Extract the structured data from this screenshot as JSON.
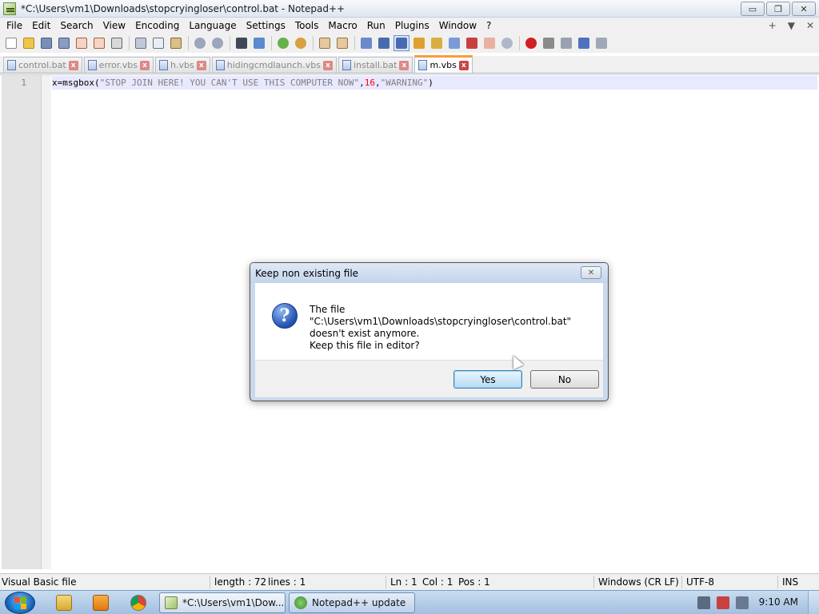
{
  "window": {
    "title": "*C:\\Users\\vm1\\Downloads\\stopcryingloser\\control.bat - Notepad++",
    "minimize_label": "▭",
    "restore_label": "❐",
    "close_label": "✕"
  },
  "menu": {
    "items": [
      "File",
      "Edit",
      "Search",
      "View",
      "Encoding",
      "Language",
      "Settings",
      "Tools",
      "Macro",
      "Run",
      "Plugins",
      "Window",
      "?"
    ],
    "right": [
      "+",
      "▼",
      "✕"
    ]
  },
  "tabs": [
    {
      "label": "control.bat",
      "active": false
    },
    {
      "label": "error.vbs",
      "active": false
    },
    {
      "label": "h.vbs",
      "active": false
    },
    {
      "label": "hidingcmdlaunch.vbs",
      "active": false
    },
    {
      "label": "install.bat",
      "active": false
    },
    {
      "label": "m.vbs",
      "active": true
    }
  ],
  "editor": {
    "line_number": "1",
    "code": {
      "part1": "x=msgbox(",
      "part2": "\"STOP JOIN HERE! YOU CAN'T USE THIS COMPUTER NOW\"",
      "part3": ",",
      "part4": "16",
      "part5": ",",
      "part6": "\"WARNING\"",
      "part7": ")"
    }
  },
  "dialog": {
    "title": "Keep non existing file",
    "close_label": "✕",
    "message_line1": "The file \"C:\\Users\\vm1\\Downloads\\stopcryingloser\\control.bat\"",
    "message_line2": "doesn't exist anymore.",
    "message_line3": "Keep this file in editor?",
    "icon_glyph": "?",
    "yes_label": "Yes",
    "no_label": "No"
  },
  "status": {
    "file_type": "Visual Basic file",
    "length": "length : 72",
    "lines": "lines : 1",
    "ln": "Ln : 1",
    "col": "Col : 1",
    "pos": "Pos : 1",
    "eol": "Windows (CR LF)",
    "encoding": "UTF-8",
    "mode": "INS"
  },
  "taskbar": {
    "task1": "*C:\\Users\\vm1\\Dow...",
    "task2": "Notepad++ update",
    "clock": "9:10 AM"
  },
  "colors": {
    "accent_tab": "#fa9b3c",
    "current_line": "#e8e8ff",
    "string": "#808080",
    "number": "#ff0000"
  }
}
